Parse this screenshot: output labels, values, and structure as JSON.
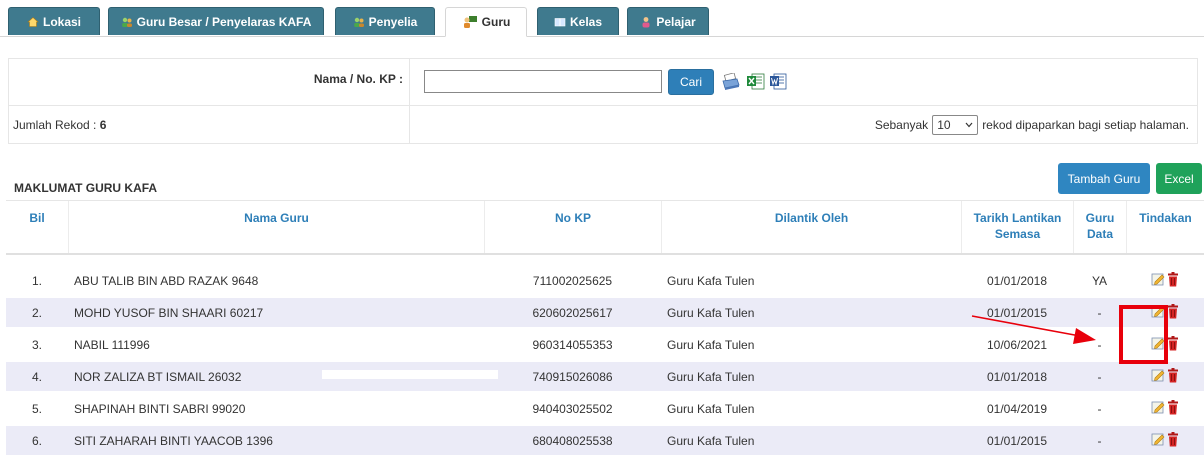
{
  "tabs": [
    {
      "label": "Lokasi",
      "icon": "home-icon"
    },
    {
      "label": "Guru Besar / Penyelaras KAFA",
      "icon": "users-icon"
    },
    {
      "label": "Penyelia",
      "icon": "users-icon"
    },
    {
      "label": "Guru",
      "icon": "teacher-icon",
      "active": true
    },
    {
      "label": "Kelas",
      "icon": "book-icon"
    },
    {
      "label": "Pelajar",
      "icon": "student-icon"
    }
  ],
  "search": {
    "label": "Nama / No. KP :",
    "value": "",
    "button": "Cari"
  },
  "records": {
    "label": "Jumlah Rekod : ",
    "count": "6",
    "per_page_prefix": "Sebanyak",
    "per_page_value": "10",
    "per_page_suffix": "rekod dipaparkan bagi setiap halaman."
  },
  "actions": {
    "add": "Tambah Guru",
    "excel": "Excel"
  },
  "section_title": "MAKLUMAT GURU KAFA",
  "columns": [
    "Bil",
    "Nama Guru",
    "No KP",
    "Dilantik Oleh",
    "Tarikh Lantikan Semasa",
    "Guru Data",
    "Tindakan"
  ],
  "rows": [
    {
      "bil": "1.",
      "nama": "ABU TALIB BIN ABD RAZAK 9648",
      "nokp": "711002025625",
      "dilantik": "Guru Kafa Tulen",
      "tarikh": "01/01/2018",
      "data": "YA"
    },
    {
      "bil": "2.",
      "nama": "MOHD YUSOF BIN SHAARI 60217",
      "nokp": "620602025617",
      "dilantik": "Guru Kafa Tulen",
      "tarikh": "01/01/2015",
      "data": "-"
    },
    {
      "bil": "3.",
      "nama": "NABIL 111996",
      "nokp": "960314055353",
      "dilantik": "Guru Kafa Tulen",
      "tarikh": "10/06/2021",
      "data": "-"
    },
    {
      "bil": "4.",
      "nama": "NOR ZALIZA BT ISMAIL 26032",
      "nokp": "740915026086",
      "dilantik": "Guru Kafa Tulen",
      "tarikh": "01/01/2018",
      "data": "-"
    },
    {
      "bil": "5.",
      "nama": "SHAPINAH BINTI SABRI 99020",
      "nokp": "940403025502",
      "dilantik": "Guru Kafa Tulen",
      "tarikh": "01/04/2019",
      "data": "-"
    },
    {
      "bil": "6.",
      "nama": "SITI ZAHARAH BINTI YAACOB 1396",
      "nokp": "680408025538",
      "dilantik": "Guru Kafa Tulen",
      "tarikh": "01/01/2015",
      "data": "-"
    }
  ],
  "colors": {
    "tab_bg": "#3f7a8e",
    "header_text": "#2e7fb8",
    "primary_button": "#2f86c1",
    "excel_button": "#1fa25a",
    "row_alt": "#ebebf7",
    "annotation": "#e8000b"
  }
}
